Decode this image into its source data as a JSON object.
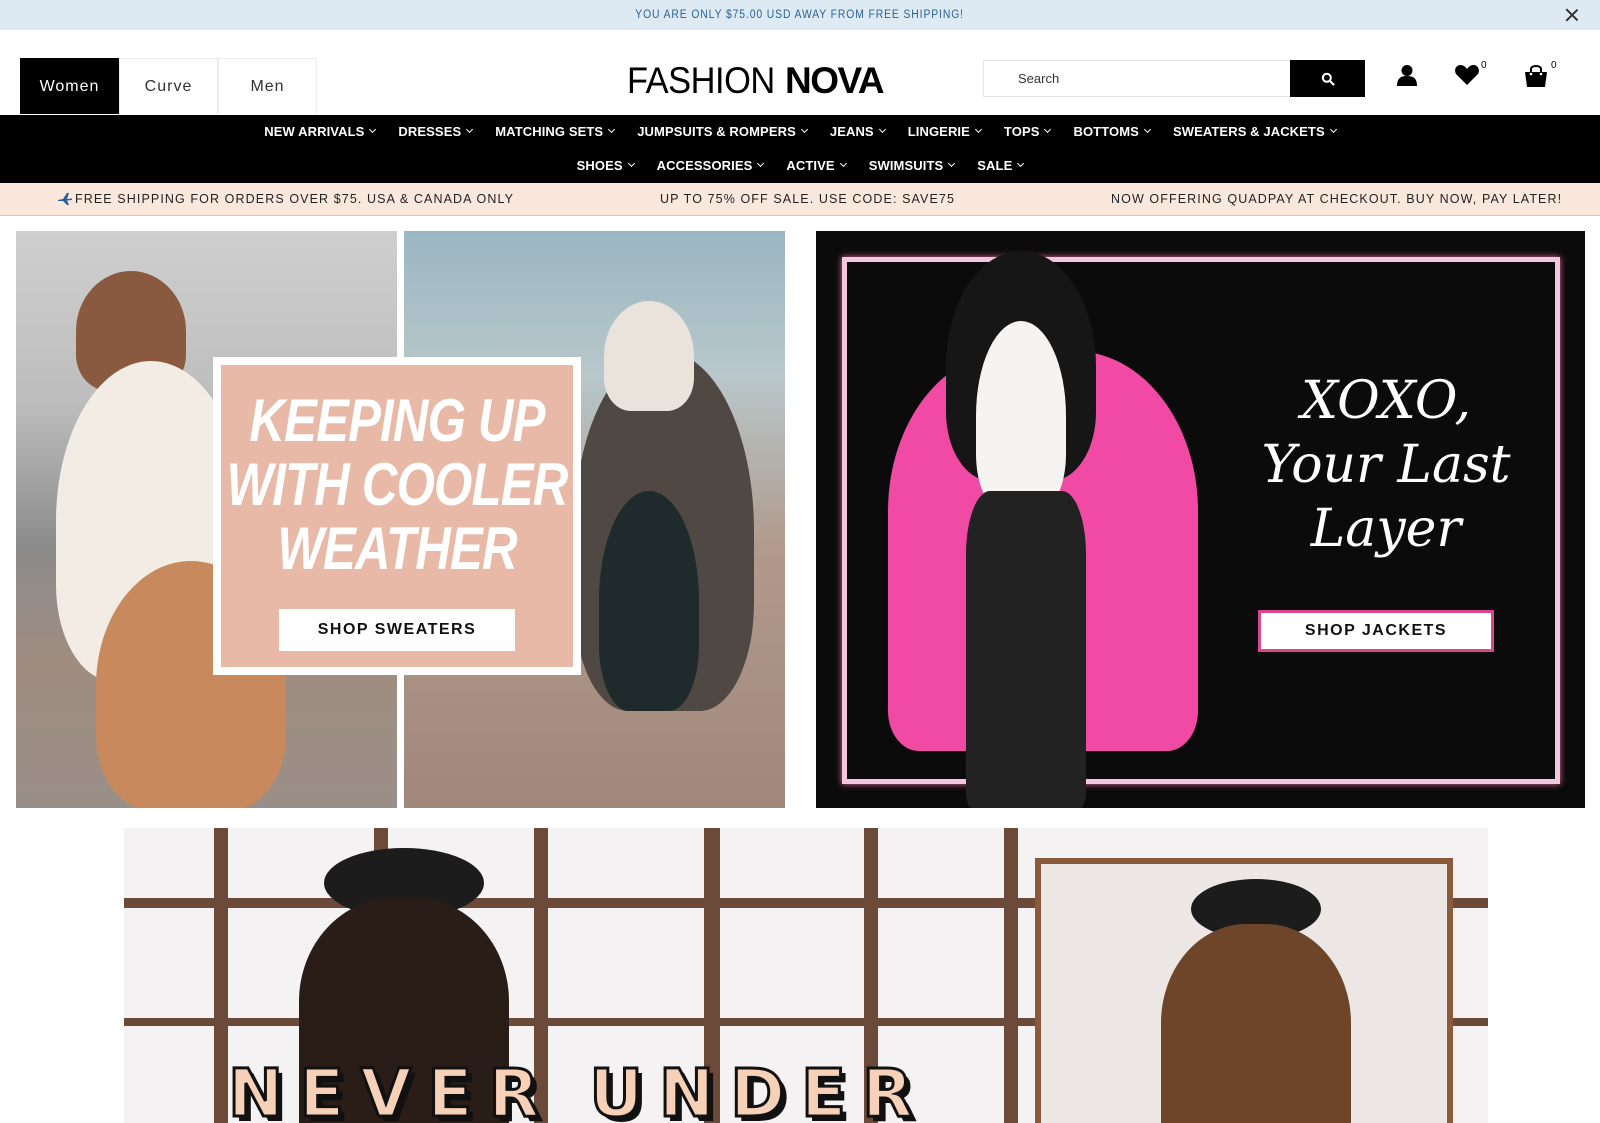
{
  "announcement": {
    "text": "YOU ARE ONLY $75.00 USD AWAY FROM FREE SHIPPING!"
  },
  "header": {
    "category_tabs": [
      {
        "label": "Women",
        "active": true
      },
      {
        "label": "Curve",
        "active": false
      },
      {
        "label": "Men",
        "active": false
      }
    ],
    "logo": {
      "light": "FASHION",
      "bold": "NOVA"
    },
    "search": {
      "placeholder": "Search",
      "value": ""
    },
    "wishlist_count": "0",
    "cart_count": "0",
    "icons": [
      "search-icon",
      "account-icon",
      "heart-icon",
      "bag-icon",
      "close-icon",
      "chevron-down-icon",
      "plane-icon"
    ]
  },
  "nav": {
    "row1": [
      "NEW ARRIVALS",
      "DRESSES",
      "MATCHING SETS",
      "JUMPSUITS & ROMPERS",
      "JEANS",
      "LINGERIE",
      "TOPS",
      "BOTTOMS",
      "SWEATERS & JACKETS"
    ],
    "row2": [
      "SHOES",
      "ACCESSORIES",
      "ACTIVE",
      "SWIMSUITS",
      "SALE"
    ]
  },
  "promo_strip": {
    "left": "FREE SHIPPING FOR ORDERS OVER $75. USA & CANADA ONLY",
    "center": "UP TO 75% OFF SALE. USE CODE: SAVE75",
    "right": "NOW OFFERING QUADPAY AT CHECKOUT. BUY NOW, PAY LATER!"
  },
  "banners": {
    "left": {
      "title": "KEEPING UP WITH COOLER WEATHER",
      "button": "SHOP SWEATERS"
    },
    "right": {
      "title_line1": "XOXO,",
      "title_line2": "Your Last",
      "title_line3": "Layer",
      "button": "SHOP JACKETS"
    },
    "bottom": {
      "letters": [
        "N",
        "E",
        "V",
        "E",
        "R",
        "U",
        "N",
        "D",
        "E",
        "R"
      ]
    }
  },
  "colors": {
    "announcement_bg": "#dde9f3",
    "announcement_text": "#2a6496",
    "nav_bg": "#000000",
    "promo_bg": "#fbe8dc",
    "card_pink": "#e7b9a6",
    "frame_pink": "#f2c6de",
    "button_border_pink": "#d9468f"
  }
}
